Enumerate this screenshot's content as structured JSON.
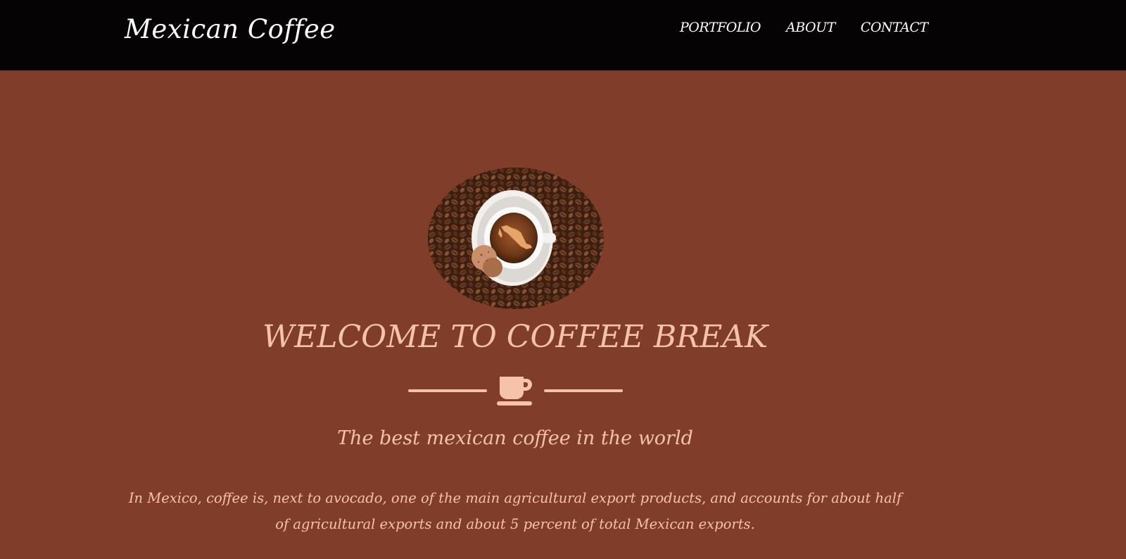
{
  "navbar": {
    "brand": "Mexican Coffee",
    "links": [
      {
        "label": "PORTFOLIO"
      },
      {
        "label": "ABOUT"
      },
      {
        "label": "CONTACT"
      }
    ]
  },
  "hero": {
    "image_alt": "Cup of coffee with map of Mexico on coffee beans",
    "title": "WELCOME TO COFFEE BREAK",
    "divider_icon": "coffee-cup-icon",
    "subtitle": "The best mexican coffee in the world",
    "description": "In Mexico, coffee is, next to avocado, one of the main agricultural export products, and accounts for about half of agricultural exports and about 5 percent of total Mexican exports."
  },
  "colors": {
    "navbar_bg": "#050303",
    "page_bg": "#803d29",
    "accent": "#f6c3a9",
    "nav_text": "#ffffff"
  }
}
